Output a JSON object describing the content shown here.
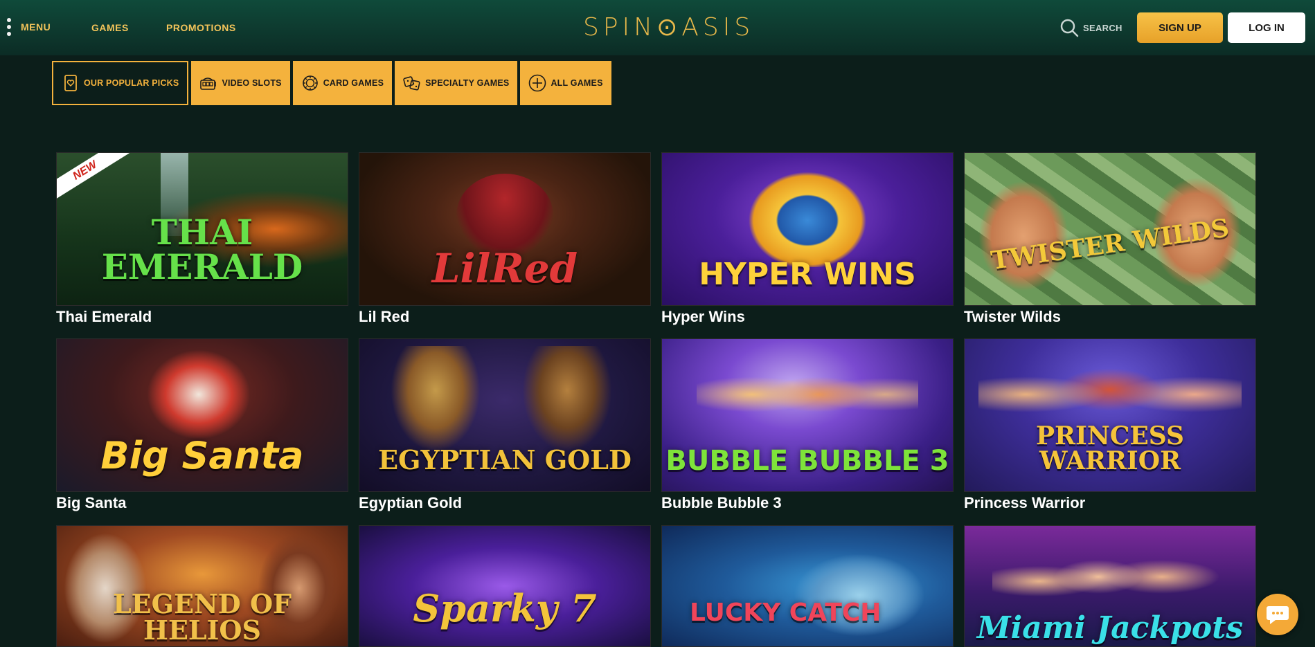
{
  "header": {
    "menu_label": "MENU",
    "games_label": "GAMES",
    "promotions_label": "PROMOTIONS",
    "logo_text": "SPIN⊙ASIS",
    "search_label": "SEARCH",
    "signup_label": "SIGN UP",
    "login_label": "LOG IN"
  },
  "tabs": [
    {
      "label": "OUR POPULAR PICKS",
      "icon": "heart-card-icon",
      "active": true
    },
    {
      "label": "VIDEO SLOTS",
      "icon": "slot-machine-icon",
      "active": false
    },
    {
      "label": "CARD GAMES",
      "icon": "poker-chip-icon",
      "active": false
    },
    {
      "label": "SPECIALTY GAMES",
      "icon": "dice-icon",
      "active": false
    },
    {
      "label": "ALL GAMES",
      "icon": "plus-circle-icon",
      "active": false
    }
  ],
  "games": [
    {
      "name": "Thai Emerald",
      "art_text": "THAI EMERALD",
      "badge": "NEW"
    },
    {
      "name": "Lil Red",
      "art_text": "LilRed",
      "badge": ""
    },
    {
      "name": "Hyper Wins",
      "art_text": "HYPER WINS",
      "badge": ""
    },
    {
      "name": "Twister Wilds",
      "art_text": "TWISTER WILDS",
      "badge": ""
    },
    {
      "name": "Big Santa",
      "art_text": "Big Santa",
      "badge": ""
    },
    {
      "name": "Egyptian Gold",
      "art_text": "EGYPTIAN GOLD",
      "badge": ""
    },
    {
      "name": "Bubble Bubble 3",
      "art_text": "BUBBLE BUBBLE 3",
      "badge": ""
    },
    {
      "name": "Princess Warrior",
      "art_text": "PRINCESS WARRIOR",
      "badge": ""
    },
    {
      "name": "",
      "art_text": "LEGEND OF HELIOS",
      "badge": ""
    },
    {
      "name": "",
      "art_text": "Sparky 7",
      "badge": ""
    },
    {
      "name": "",
      "art_text": "LUCKY CATCH",
      "badge": ""
    },
    {
      "name": "",
      "art_text": "Miami Jackpots",
      "badge": ""
    }
  ],
  "colors": {
    "accent": "#f4b23d",
    "background": "#0c1e1a",
    "header_top": "#0f4a3a"
  }
}
